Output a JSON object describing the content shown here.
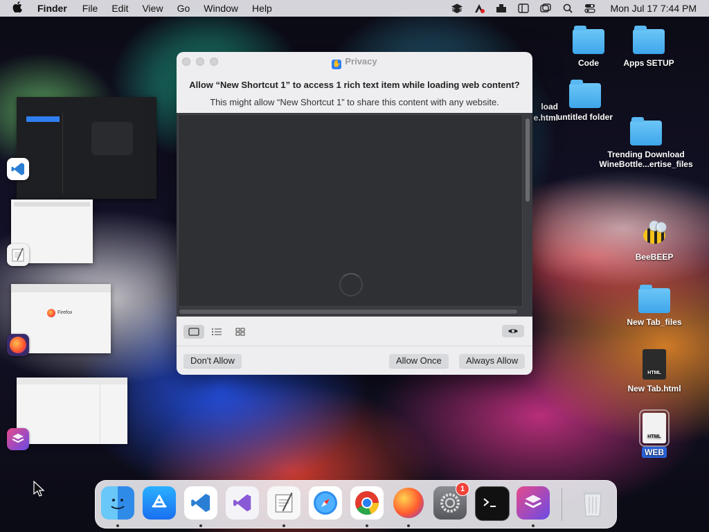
{
  "menubar": {
    "app": "Finder",
    "items": [
      "File",
      "Edit",
      "View",
      "Go",
      "Window",
      "Help"
    ],
    "clock": "Mon Jul 17  7:44 PM"
  },
  "desktop": {
    "icons": [
      {
        "label": "Code",
        "kind": "folder"
      },
      {
        "label": "Apps SETUP",
        "kind": "folder"
      },
      {
        "label": "untitled folder",
        "kind": "folder"
      },
      {
        "label": "Trending Download WineBottle...ertise_files",
        "kind": "folder"
      },
      {
        "label": "BeeBEEP",
        "kind": "app"
      },
      {
        "label": "New Tab_files",
        "kind": "folder"
      },
      {
        "label": "New Tab.html",
        "kind": "document"
      },
      {
        "label": "WEB",
        "kind": "document"
      }
    ],
    "partial_text": [
      "load",
      "e.html"
    ]
  },
  "thumbnails": {
    "firefox_label": "Firefox"
  },
  "dialog": {
    "title": "Privacy",
    "headline": "Allow “New Shortcut 1” to access 1 rich text item while loading web content?",
    "subline": "This might allow “New Shortcut 1” to share this content with any website.",
    "buttons": {
      "deny": "Don't Allow",
      "once": "Allow Once",
      "always": "Always Allow"
    }
  },
  "dock": {
    "items": [
      "Finder",
      "App Store",
      "Visual Studio Code",
      "Visual Studio",
      "TextEdit",
      "Safari",
      "Chrome",
      "Firefox",
      "System Settings",
      "Terminal",
      "Shortcuts",
      "Trash"
    ],
    "settings_badge": "1",
    "doc_icon_labels": {
      "new_tab": "HTML",
      "web": "HTML"
    }
  },
  "colors": {
    "accent": "#2f7ff2",
    "selection": "#2a62d9"
  }
}
